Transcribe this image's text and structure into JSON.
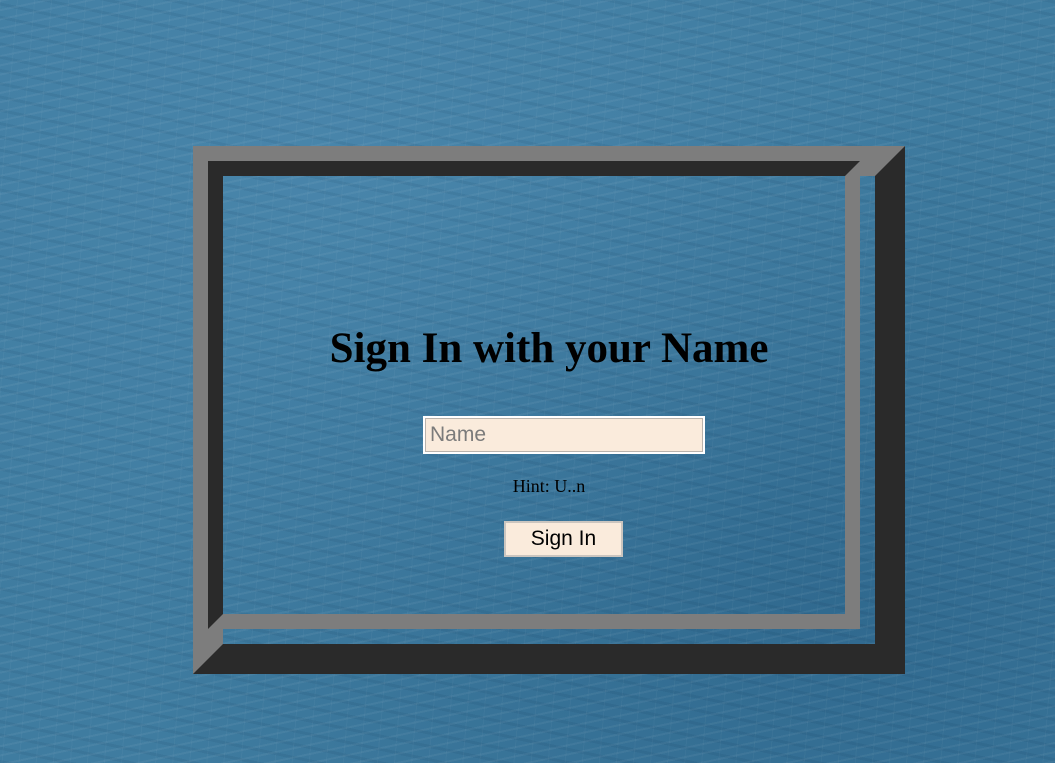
{
  "signin": {
    "title": "Sign In with your Name",
    "name_placeholder": "Name",
    "name_value": "",
    "hint": "Hint: U..n",
    "button_label": "Sign In"
  },
  "colors": {
    "background": "#3f7ca0",
    "frame_light": "#7d7d7d",
    "frame_dark": "#2a2a2a",
    "input_background": "#faebdc"
  }
}
